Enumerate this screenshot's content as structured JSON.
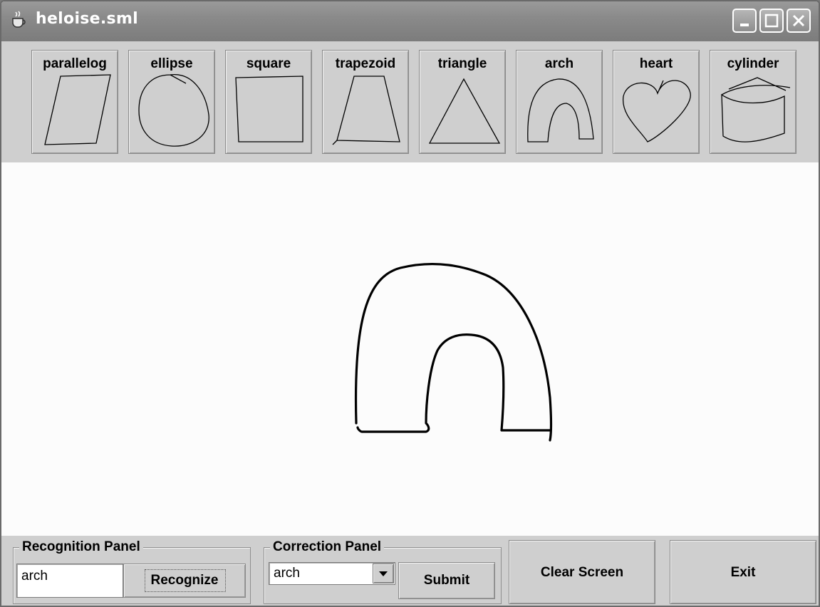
{
  "window": {
    "title": "heloise.sml",
    "app_icon": "java-cup-icon",
    "controls": [
      "minimize-icon",
      "maximize-icon",
      "close-icon"
    ]
  },
  "templates": [
    {
      "label": "parallelog",
      "shape": "parallelogram"
    },
    {
      "label": "ellipse",
      "shape": "ellipse"
    },
    {
      "label": "square",
      "shape": "square"
    },
    {
      "label": "trapezoid",
      "shape": "trapezoid"
    },
    {
      "label": "triangle",
      "shape": "triangle"
    },
    {
      "label": "arch",
      "shape": "arch"
    },
    {
      "label": "heart",
      "shape": "heart"
    },
    {
      "label": "cylinder",
      "shape": "cylinder"
    }
  ],
  "canvas": {
    "drawing": "arch"
  },
  "recognition_panel": {
    "title": "Recognition Panel",
    "result_value": "arch",
    "recognize_label": "Recognize"
  },
  "correction_panel": {
    "title": "Correction Panel",
    "selected": "arch",
    "submit_label": "Submit"
  },
  "actions": {
    "clear_label": "Clear Screen",
    "exit_label": "Exit"
  },
  "colors": {
    "panel": "#cfcfcf",
    "canvas": "#fcfcfc",
    "titlebar": "#8a8a8a",
    "ink": "#000000"
  }
}
